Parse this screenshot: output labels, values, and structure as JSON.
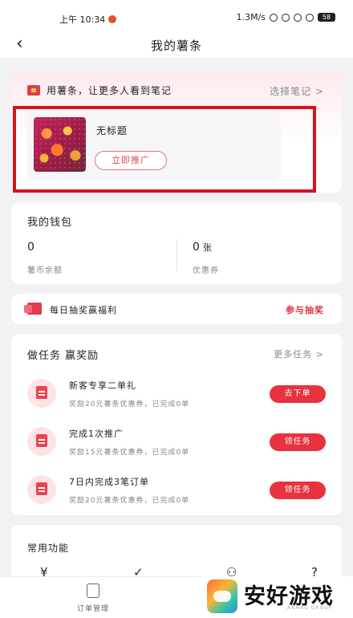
{
  "status_bar": {
    "time": "上午 10:34",
    "network": "1.3M/s",
    "battery": "58"
  },
  "nav": {
    "back_icon": "chevron-left-icon",
    "title": "我的薯条"
  },
  "promo": {
    "header": "用薯条，让更多人看到笔记",
    "select_note": "选择笔记 >",
    "note_title": "无标题",
    "promote_button": "立即推广"
  },
  "wallet": {
    "title": "我的钱包",
    "coin_value": "0",
    "coin_label": "薯币余额",
    "coupon_value": "0",
    "coupon_unit": "张",
    "coupon_label": "优惠券"
  },
  "lottery": {
    "text": "每日抽奖赢福利",
    "action": "参与抽奖"
  },
  "tasks": {
    "title": "做任务 赢奖励",
    "more": "更多任务 >",
    "items": [
      {
        "name": "新客专享二单礼",
        "desc": "奖励20元薯条优惠券，已完成0单",
        "button": "去下单"
      },
      {
        "name": "完成1次推广",
        "desc": "奖励15元薯条优惠券，已完成0单",
        "button": "领任务"
      },
      {
        "name": "7日内完成3笔订单",
        "desc": "奖励20元薯条优惠券，已完成0单",
        "button": "领任务"
      }
    ]
  },
  "common": {
    "title": "常用功能",
    "icons": [
      "¥",
      "✓",
      "⚇",
      "?"
    ]
  },
  "bottom": {
    "orders_label": "订单管理"
  },
  "watermark": {
    "text": "安好游戏",
    "sub": "ANHAO GROUP"
  },
  "colors": {
    "accent": "#e8323f",
    "highlight_box": "#d9111e",
    "background": "#f2f2f4"
  }
}
